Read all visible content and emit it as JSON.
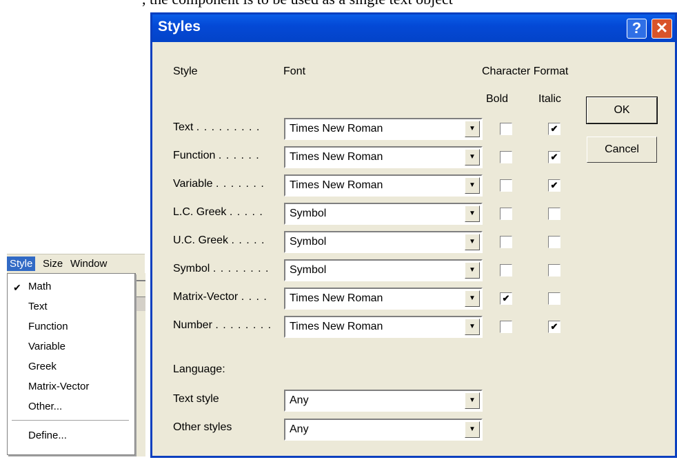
{
  "top_text": ", the component is to be used as a single text object",
  "menu": {
    "bar": [
      {
        "label": "Style",
        "active": true
      },
      {
        "label": "Size",
        "active": false
      },
      {
        "label": "Window",
        "active": false
      }
    ],
    "items": [
      {
        "label": "Math",
        "checked": true
      },
      {
        "label": "Text"
      },
      {
        "label": "Function"
      },
      {
        "label": "Variable"
      },
      {
        "label": "Greek"
      },
      {
        "label": "Matrix-Vector"
      },
      {
        "label": "Other..."
      },
      {
        "label": "Define..."
      }
    ],
    "check_glyph": "✔"
  },
  "dialog": {
    "title": "Styles",
    "help_label": "?",
    "close_label": "✕",
    "headers": {
      "style": "Style",
      "font": "Font",
      "char_format": "Character Format",
      "bold": "Bold",
      "italic": "Italic"
    },
    "rows": [
      {
        "name": "Text",
        "dots": ". . . . . . . . .",
        "font": "Times New Roman",
        "bold": false,
        "italic": true
      },
      {
        "name": "Function",
        "dots": ". . . . . .",
        "font": "Times New Roman",
        "bold": false,
        "italic": true
      },
      {
        "name": "Variable",
        "dots": ". . . . . . .",
        "font": "Times New Roman",
        "bold": false,
        "italic": true
      },
      {
        "name": "L.C. Greek",
        "dots": ". . . . .",
        "font": "Symbol",
        "bold": false,
        "italic": false
      },
      {
        "name": "U.C. Greek",
        "dots": ". . . . .",
        "font": "Symbol",
        "bold": false,
        "italic": false
      },
      {
        "name": "Symbol",
        "dots": ". . . . . . . .",
        "font": "Symbol",
        "bold": false,
        "italic": false
      },
      {
        "name": "Matrix-Vector",
        "dots": ". . . .",
        "font": "Times New Roman",
        "bold": true,
        "italic": false
      },
      {
        "name": "Number",
        "dots": ". . . . . . . .",
        "font": "Times New Roman",
        "bold": false,
        "italic": true
      }
    ],
    "language_label": "Language:",
    "text_style_label": "Text style",
    "text_style_value": "Any",
    "other_styles_label": "Other styles",
    "other_styles_value": "Any",
    "ok_label": "OK",
    "cancel_label": "Cancel",
    "check_glyph": "✔",
    "dropdown_glyph": "▼"
  }
}
